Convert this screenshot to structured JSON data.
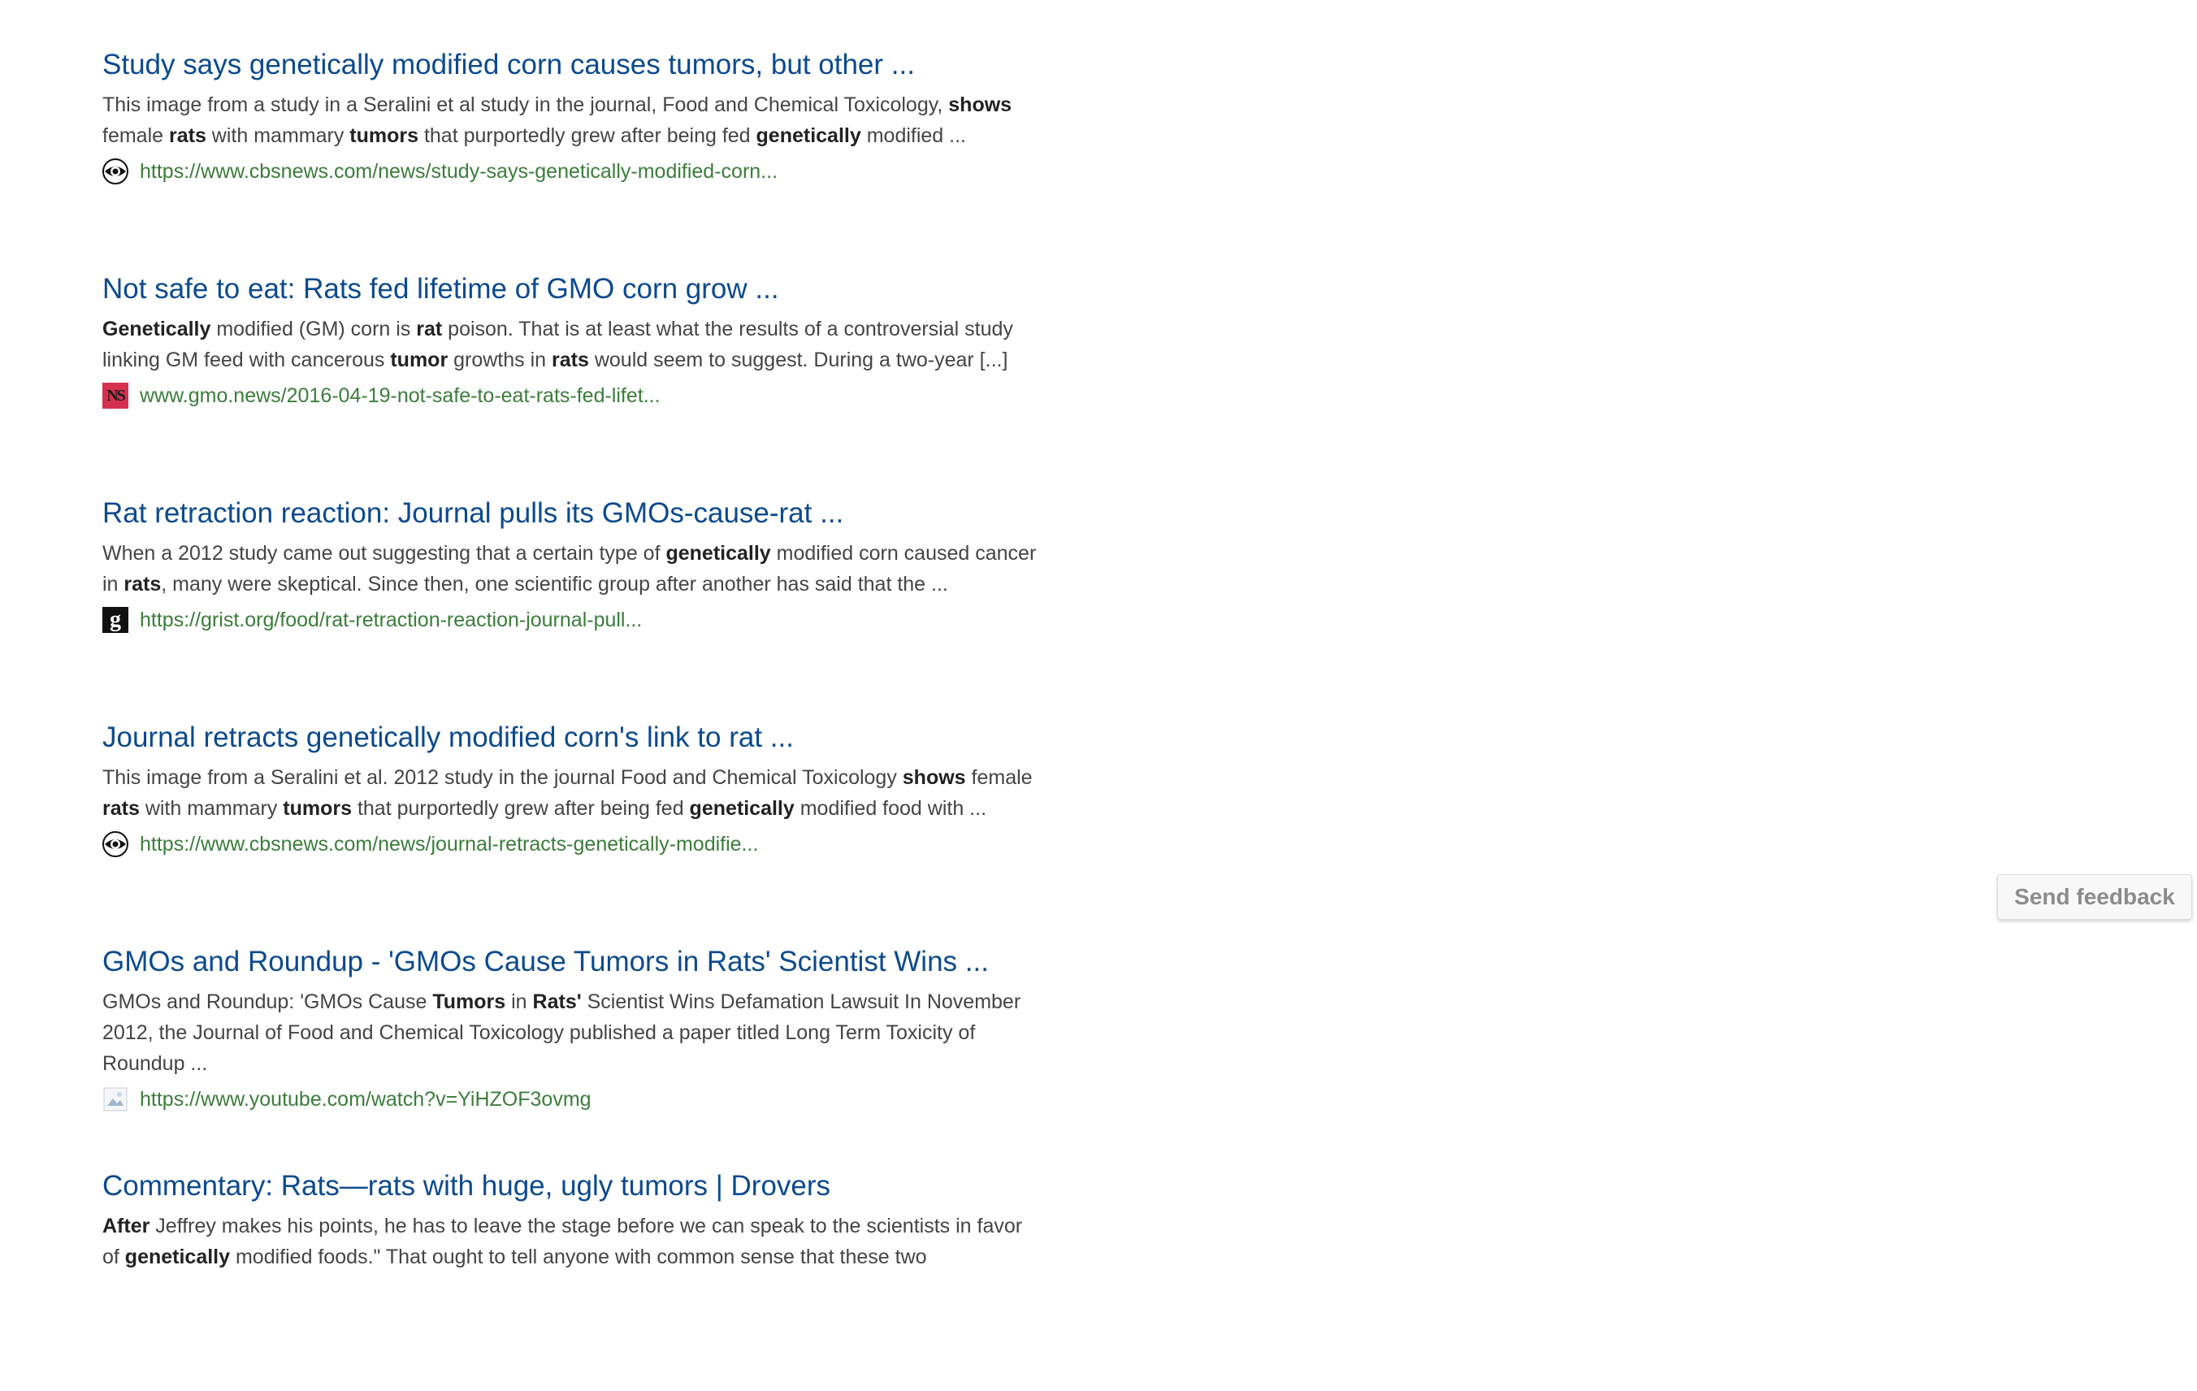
{
  "results": [
    {
      "title": "Study says genetically modified corn causes tumors, but other ...",
      "snippet": [
        {
          "t": "This image from a study in a Seralini et al study in the journal, Food and Chemical Toxicology, "
        },
        {
          "t": "shows",
          "b": true
        },
        {
          "t": " female "
        },
        {
          "t": "rats",
          "b": true
        },
        {
          "t": " with mammary "
        },
        {
          "t": "tumors",
          "b": true
        },
        {
          "t": " that purportedly grew after being fed "
        },
        {
          "t": "genetically",
          "b": true
        },
        {
          "t": " modified ..."
        }
      ],
      "url": "https://www.cbsnews.com/news/study-says-genetically-modified-corn...",
      "favicon": "eye-icon"
    },
    {
      "title": "Not safe to eat: Rats fed lifetime of GMO corn grow ...",
      "snippet": [
        {
          "t": "Genetically",
          "b": true
        },
        {
          "t": " modified (GM) corn is "
        },
        {
          "t": "rat",
          "b": true
        },
        {
          "t": " poison. That is at least what the results of a controversial study linking GM feed with cancerous "
        },
        {
          "t": "tumor",
          "b": true
        },
        {
          "t": " growths in "
        },
        {
          "t": "rats",
          "b": true
        },
        {
          "t": " would seem to suggest. During a two-year [...]"
        }
      ],
      "url": "www.gmo.news/2016-04-19-not-safe-to-eat-rats-fed-lifet...",
      "favicon": "ns-icon",
      "favicon_text": "NS"
    },
    {
      "title": "Rat retraction reaction: Journal pulls its GMOs-cause-rat ...",
      "snippet": [
        {
          "t": "When a 2012 study came out suggesting that a certain type of "
        },
        {
          "t": "genetically",
          "b": true
        },
        {
          "t": " modified corn caused cancer in "
        },
        {
          "t": "rats",
          "b": true
        },
        {
          "t": ", many were skeptical. Since then, one scientific group after another has said that the ..."
        }
      ],
      "url": "https://grist.org/food/rat-retraction-reaction-journal-pull...",
      "favicon": "grist-icon",
      "favicon_text": "g"
    },
    {
      "title": "Journal retracts genetically modified corn's link to rat ...",
      "snippet": [
        {
          "t": "This image from a Seralini et al. 2012 study in the journal Food and Chemical Toxicology "
        },
        {
          "t": "shows",
          "b": true
        },
        {
          "t": " female "
        },
        {
          "t": "rats",
          "b": true
        },
        {
          "t": " with mammary "
        },
        {
          "t": "tumors",
          "b": true
        },
        {
          "t": " that purportedly grew after being fed "
        },
        {
          "t": "genetically",
          "b": true
        },
        {
          "t": " modified food with ..."
        }
      ],
      "url": "https://www.cbsnews.com/news/journal-retracts-genetically-modifie...",
      "favicon": "eye-icon"
    },
    {
      "title": "GMOs and Roundup - 'GMOs Cause Tumors in Rats' Scientist Wins ...",
      "snippet": [
        {
          "t": "GMOs and Roundup: 'GMOs Cause "
        },
        {
          "t": "Tumors",
          "b": true
        },
        {
          "t": " in "
        },
        {
          "t": "Rats'",
          "b": true
        },
        {
          "t": " Scientist Wins Defamation Lawsuit In November 2012, the Journal of Food and Chemical Toxicology published a paper titled Long Term Toxicity of Roundup ..."
        }
      ],
      "url": "https://www.youtube.com/watch?v=YiHZOF3ovmg",
      "favicon": "broken-image-icon"
    },
    {
      "title": "Commentary: Rats—rats with huge, ugly tumors | Drovers",
      "snippet": [
        {
          "t": "After",
          "b": true
        },
        {
          "t": " Jeffrey makes his points, he has to leave the stage before we can speak to the scientists in favor of "
        },
        {
          "t": "genetically",
          "b": true
        },
        {
          "t": " modified foods.\" That ought to tell anyone with common sense that these two"
        }
      ],
      "url": "",
      "favicon": ""
    }
  ],
  "feedback": {
    "label": "Send feedback"
  },
  "colors": {
    "title": "#0b4a8f",
    "url": "#3a7d3a",
    "snippet": "#444444"
  }
}
